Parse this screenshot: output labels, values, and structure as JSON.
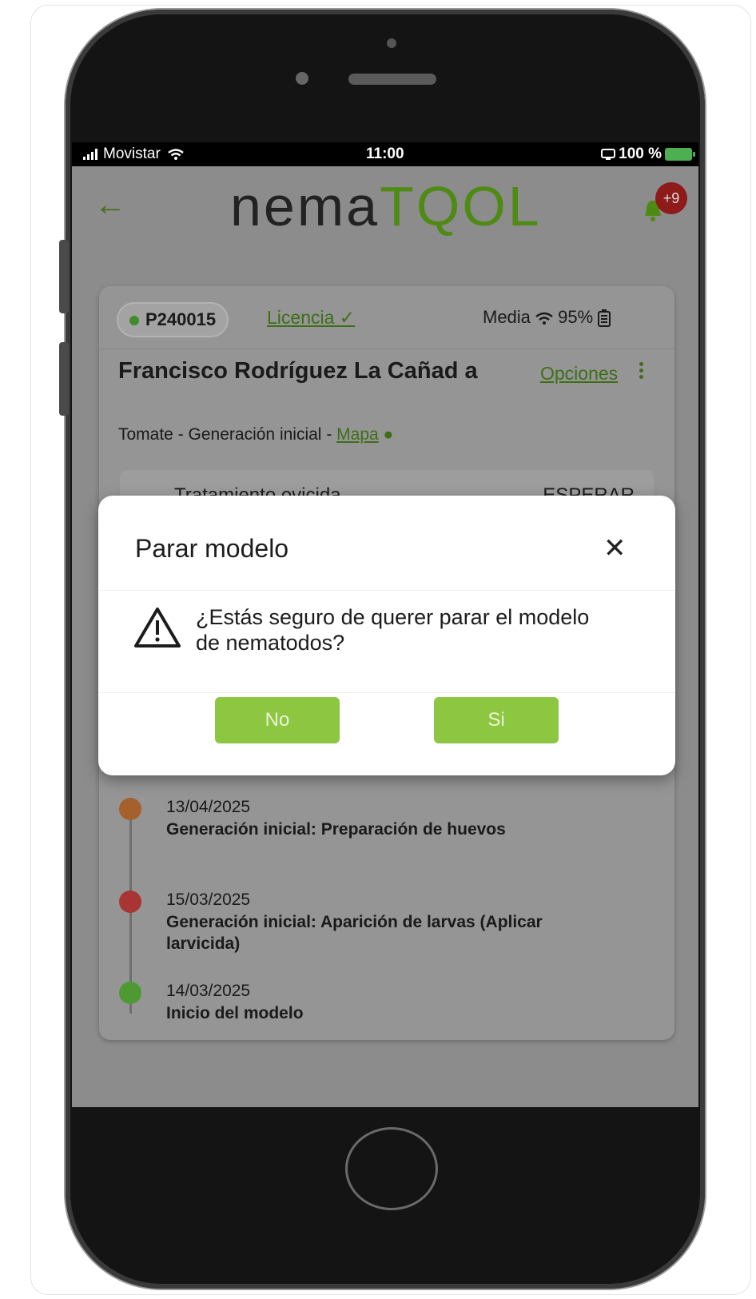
{
  "status_bar": {
    "carrier": "Movistar",
    "time": "11:00",
    "battery": "100 %"
  },
  "header": {
    "logo_text_dark": "nema",
    "logo_text_green": "TQOL",
    "notification_badge": "+9"
  },
  "card": {
    "plot_id": "P240015",
    "license_label": "Licencia",
    "signal_text": "Media",
    "signal_percent": "95%",
    "farm_name": "Francisco Rodríguez La Cañad a",
    "options_label": "Opciones",
    "crop": "Tomate",
    "generation": "Generación inicial",
    "map_label": "Mapa",
    "separator": " - ",
    "hidden_row_left": "Tratamiento ovicida",
    "hidden_row_right": "ESPERAR"
  },
  "timeline": [
    {
      "date": "13/04/2025",
      "title": "Generación inicial: Preparación de huevos",
      "color": "#a5602b"
    },
    {
      "date": "15/03/2025",
      "title": "Generación inicial: Aparición de larvas (Aplicar larvicida)",
      "color": "#a83434"
    },
    {
      "date": "14/03/2025",
      "title": "Inicio del modelo",
      "color": "#4e9a32"
    }
  ],
  "modal": {
    "title": "Parar modelo",
    "message": "¿Estás seguro de querer parar el modelo de nematodos?",
    "no_label": "No",
    "yes_label": "Si"
  },
  "colors": {
    "accent_green": "#8dc641",
    "link_green": "#3e6e18"
  }
}
